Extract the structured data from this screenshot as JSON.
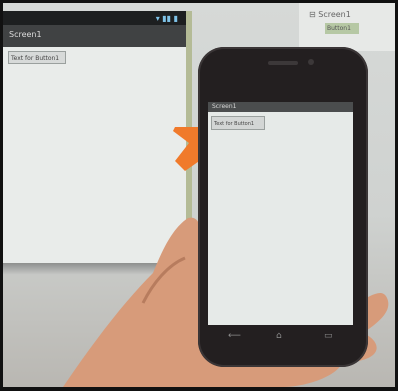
{
  "designer": {
    "screen_title": "Screen1",
    "button_label": "Text for Button1"
  },
  "components_tree": {
    "root_label": "Screen1",
    "child_label": "Button1"
  },
  "phone": {
    "screen_title": "Screen1",
    "button_label": "Text for Button1"
  },
  "colors": {
    "arrow": "#f07a2b",
    "selection": "#b6c8a4"
  },
  "icons": {
    "nav_back": "back-icon",
    "nav_home": "home-icon",
    "nav_recents": "recents-icon"
  }
}
